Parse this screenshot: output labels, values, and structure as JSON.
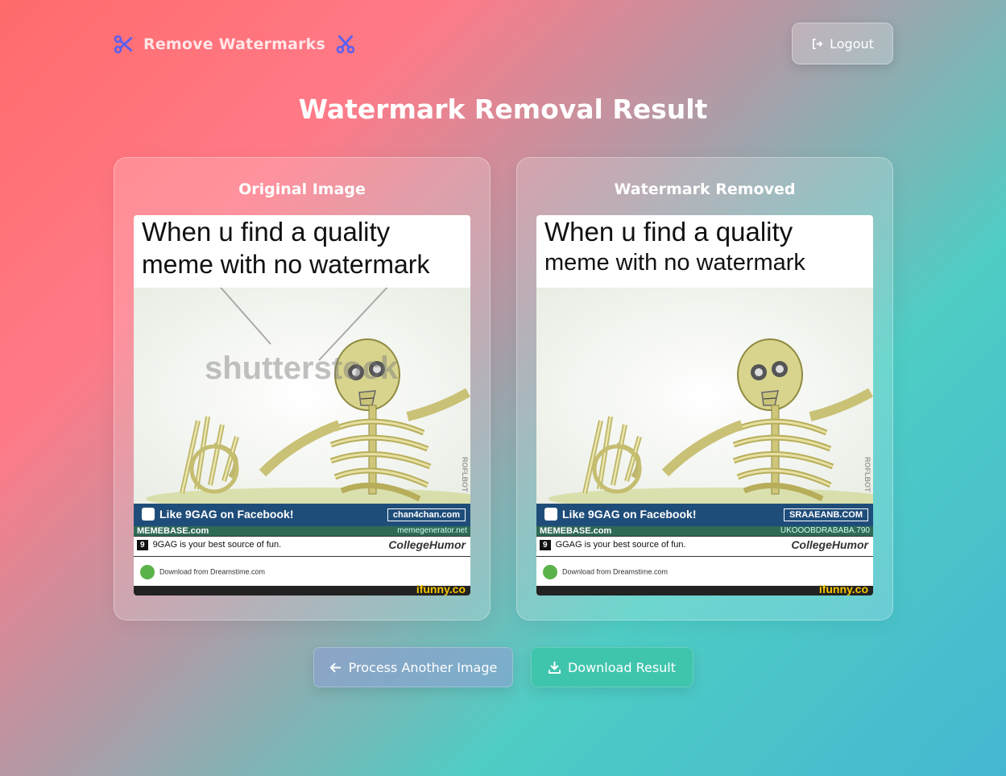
{
  "header": {
    "brand": "Remove Watermarks",
    "brand_icon": "scissors-icon",
    "logout_label": "Logout",
    "logout_icon": "sign-out-icon"
  },
  "page_title": "Watermark Removal Result",
  "cards": {
    "original": {
      "title": "Original Image",
      "meme": {
        "caption_line1": "When u find a quality",
        "caption_line2": "meme with no watermark",
        "watermark": "shutterstock",
        "fb_banner": "Like 9GAG on Facebook!",
        "chan_tag": "chan4chan.com",
        "memebase": "MEMEBASE.com",
        "memegen": "memegenerator.net",
        "ninegag_text": "9GAG is your best source of fun.",
        "collegehumor": "CollegeHumor",
        "dreamstime": "Download from Dreamstime.com",
        "ifunny": "ifunny.co",
        "side_tag": "ROFLBOT"
      }
    },
    "removed": {
      "title": "Watermark Removed",
      "meme": {
        "caption_line1": "When u find a quality",
        "caption_line2": "meme with no watermark",
        "fb_banner": "Like 9GAG on Facebook!",
        "chan_tag": "SRAAEANB.COM",
        "memebase": "MEMEBASE.com",
        "memegen": "UKOOOBDRABABA.790",
        "ninegag_text": "GGAG is your best source of fun.",
        "collegehumor": "CollegeHumor",
        "dreamstime": "Download from Dreamstime.com",
        "ifunny": "ifunny.co",
        "side_tag": "ROFLBOT"
      }
    }
  },
  "actions": {
    "process_label": "Process Another Image",
    "process_icon": "arrow-left-icon",
    "download_label": "Download Result",
    "download_icon": "download-icon"
  },
  "colors": {
    "icon_accent": "#5b5ff0",
    "download_bg": "#40c5ad"
  }
}
